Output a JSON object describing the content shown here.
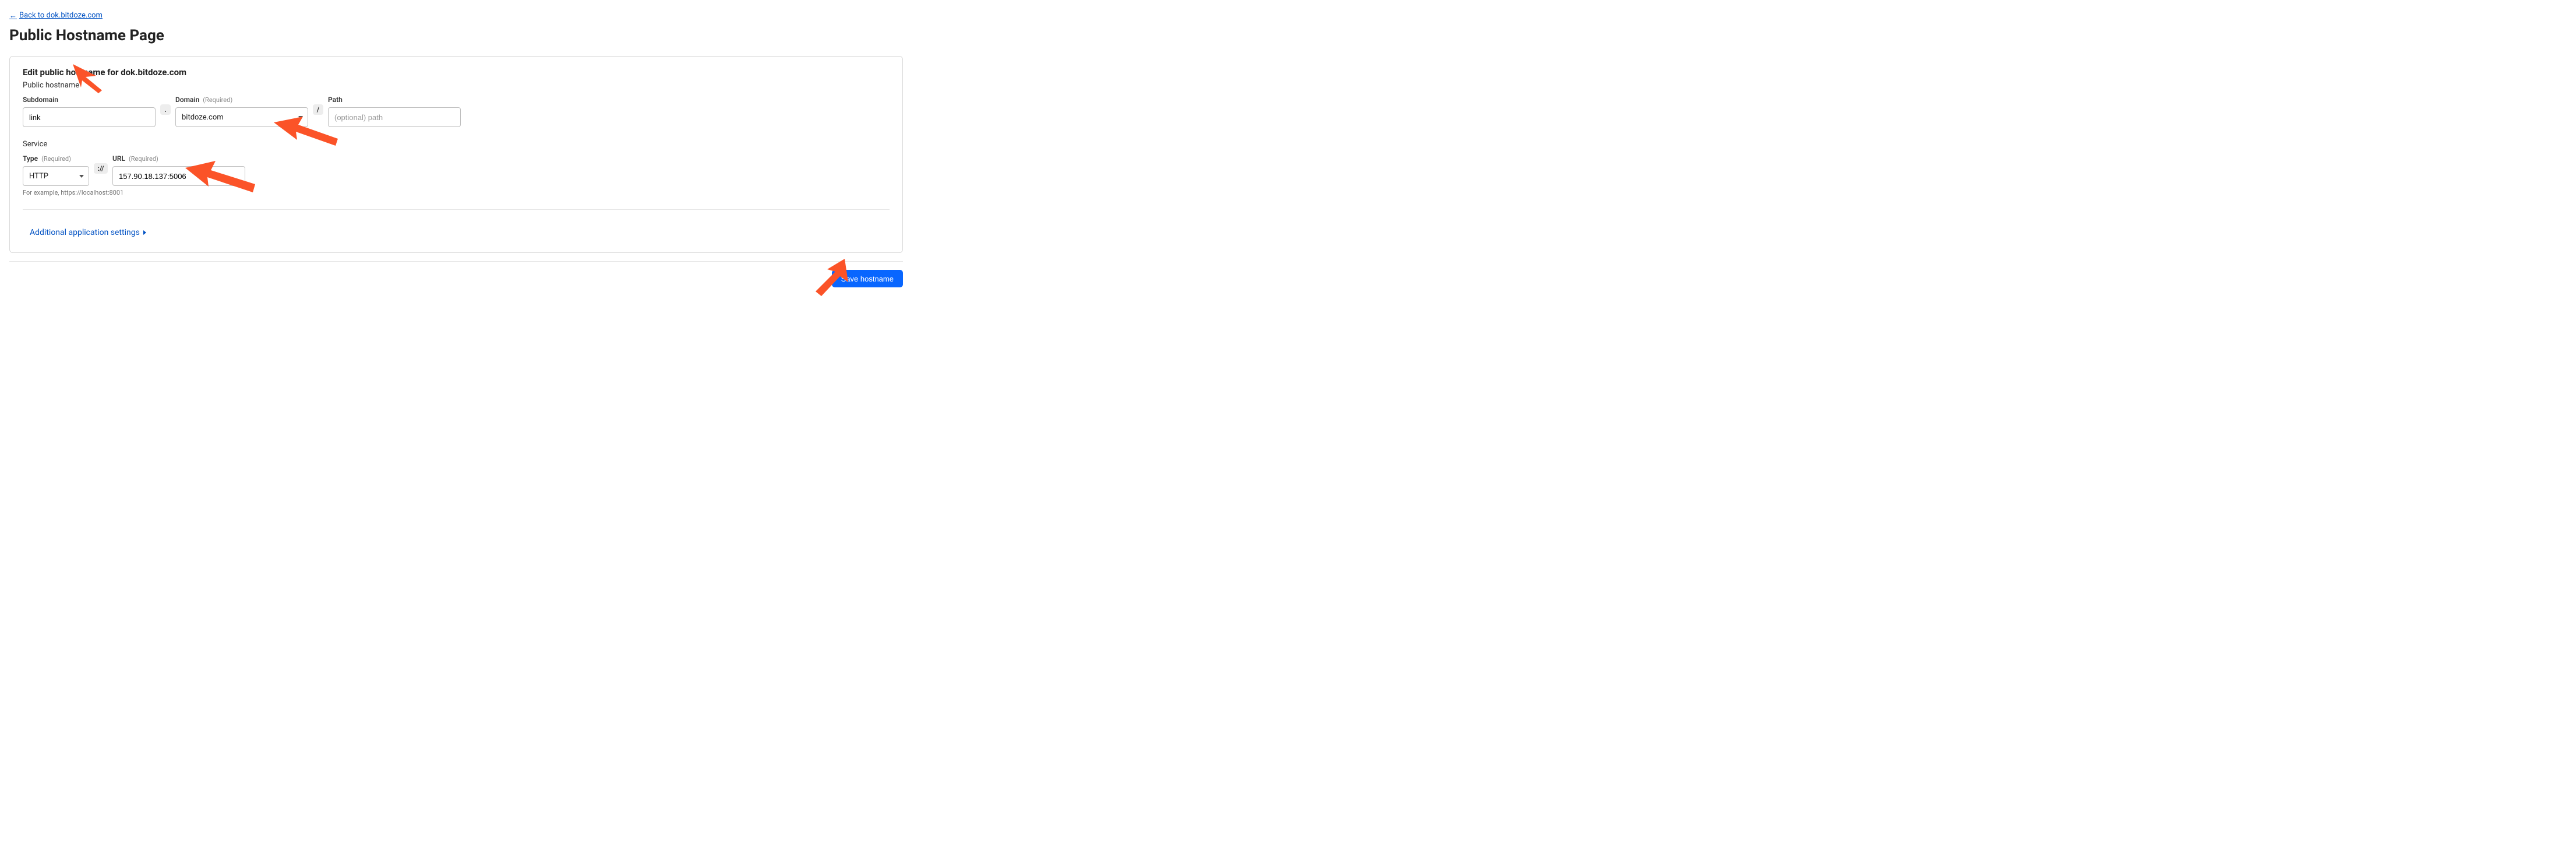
{
  "back_link": {
    "label": "Back to dok.bitdoze.com"
  },
  "page_title": "Public Hostname Page",
  "card": {
    "title": "Edit public hostname for dok.bitdoze.com"
  },
  "public_hostname": {
    "section_label": "Public hostname",
    "subdomain": {
      "label": "Subdomain",
      "value": "link"
    },
    "domain": {
      "label": "Domain",
      "required": "(Required)",
      "value": "bitdoze.com"
    },
    "path": {
      "label": "Path",
      "placeholder": "(optional) path",
      "value": ""
    },
    "sep_dot": ".",
    "sep_slash": "/"
  },
  "service": {
    "section_label": "Service",
    "type": {
      "label": "Type",
      "required": "(Required)",
      "value": "HTTP"
    },
    "url": {
      "label": "URL",
      "required": "(Required)",
      "value": "157.90.18.137:5006"
    },
    "sep_scheme": "://",
    "hint": "For example, https://localhost:8001"
  },
  "additional_settings": {
    "label": "Additional application settings"
  },
  "save_button": {
    "label": "Save hostname"
  },
  "colors": {
    "accent_link": "#0051c3",
    "accent_button": "#0866ff",
    "annotation_arrow": "#fb5328"
  }
}
